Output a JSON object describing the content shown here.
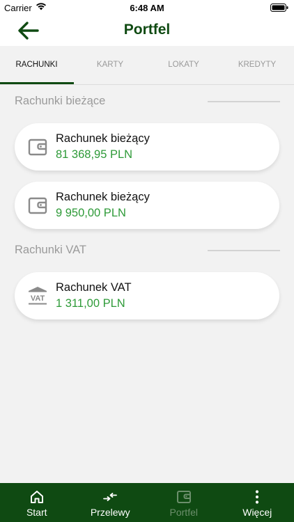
{
  "status_bar": {
    "carrier": "Carrier",
    "time": "6:48 AM"
  },
  "header": {
    "title": "Portfel"
  },
  "tabs": [
    {
      "label": "RACHUNKI",
      "active": true
    },
    {
      "label": "KARTY",
      "active": false
    },
    {
      "label": "LOKATY",
      "active": false
    },
    {
      "label": "KREDYTY",
      "active": false
    }
  ],
  "sections": [
    {
      "title": "Rachunki bieżące",
      "accounts": [
        {
          "name": "Rachunek bieżący",
          "amount": "81 368,95 PLN",
          "icon": "wallet-icon"
        },
        {
          "name": "Rachunek bieżący",
          "amount": "9 950,00 PLN",
          "icon": "wallet-icon"
        }
      ]
    },
    {
      "title": "Rachunki VAT",
      "accounts": [
        {
          "name": "Rachunek VAT",
          "amount": "1 311,00 PLN",
          "icon": "vat-bank-icon",
          "icon_text": "VAT"
        }
      ]
    }
  ],
  "bottom_nav": [
    {
      "label": "Start",
      "icon": "home-icon",
      "active": false
    },
    {
      "label": "Przelewy",
      "icon": "transfer-icon",
      "active": false
    },
    {
      "label": "Portfel",
      "icon": "wallet-icon",
      "active": true
    },
    {
      "label": "Więcej",
      "icon": "more-icon",
      "active": false
    }
  ],
  "colors": {
    "brand": "#0f4a12",
    "amount": "#2e9a38",
    "muted": "#9a9a9a",
    "background": "#f2f2f2"
  }
}
